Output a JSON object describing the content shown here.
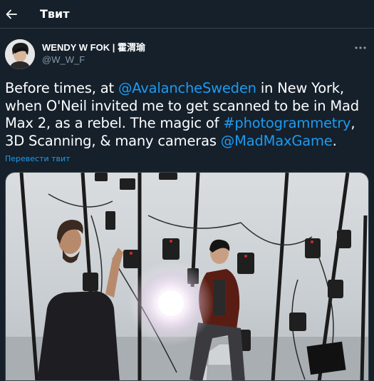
{
  "header": {
    "title": "Твит",
    "back_icon": "arrow-left-icon"
  },
  "author": {
    "display_name": "WENDY W FOK | 霍渭瑜",
    "handle": "@W_W_F",
    "avatar": "avatar-photo",
    "more_icon": "more-dots-icon"
  },
  "tweet": {
    "segments": [
      {
        "text": "Before times, at ",
        "link": false
      },
      {
        "text": "@AvalancheSweden",
        "link": true
      },
      {
        "text": " in New York, when O'Neil invited me to get scanned to be in Mad Max 2, as a rebel. The magic of ",
        "link": false
      },
      {
        "text": "#photogrammetry",
        "link": true
      },
      {
        "text": ", 3D Scanning, & many cameras ",
        "link": false
      },
      {
        "text": "@MadMaxGame",
        "link": true
      },
      {
        "text": ".",
        "link": false
      }
    ],
    "translate_label": "Перевести твит"
  },
  "media": {
    "kind": "photo",
    "subject": "photogrammetry-studio"
  },
  "colors": {
    "background": "#15202b",
    "link": "#1d9bf0",
    "secondary_text": "#8899a6",
    "divider": "#38444d"
  }
}
